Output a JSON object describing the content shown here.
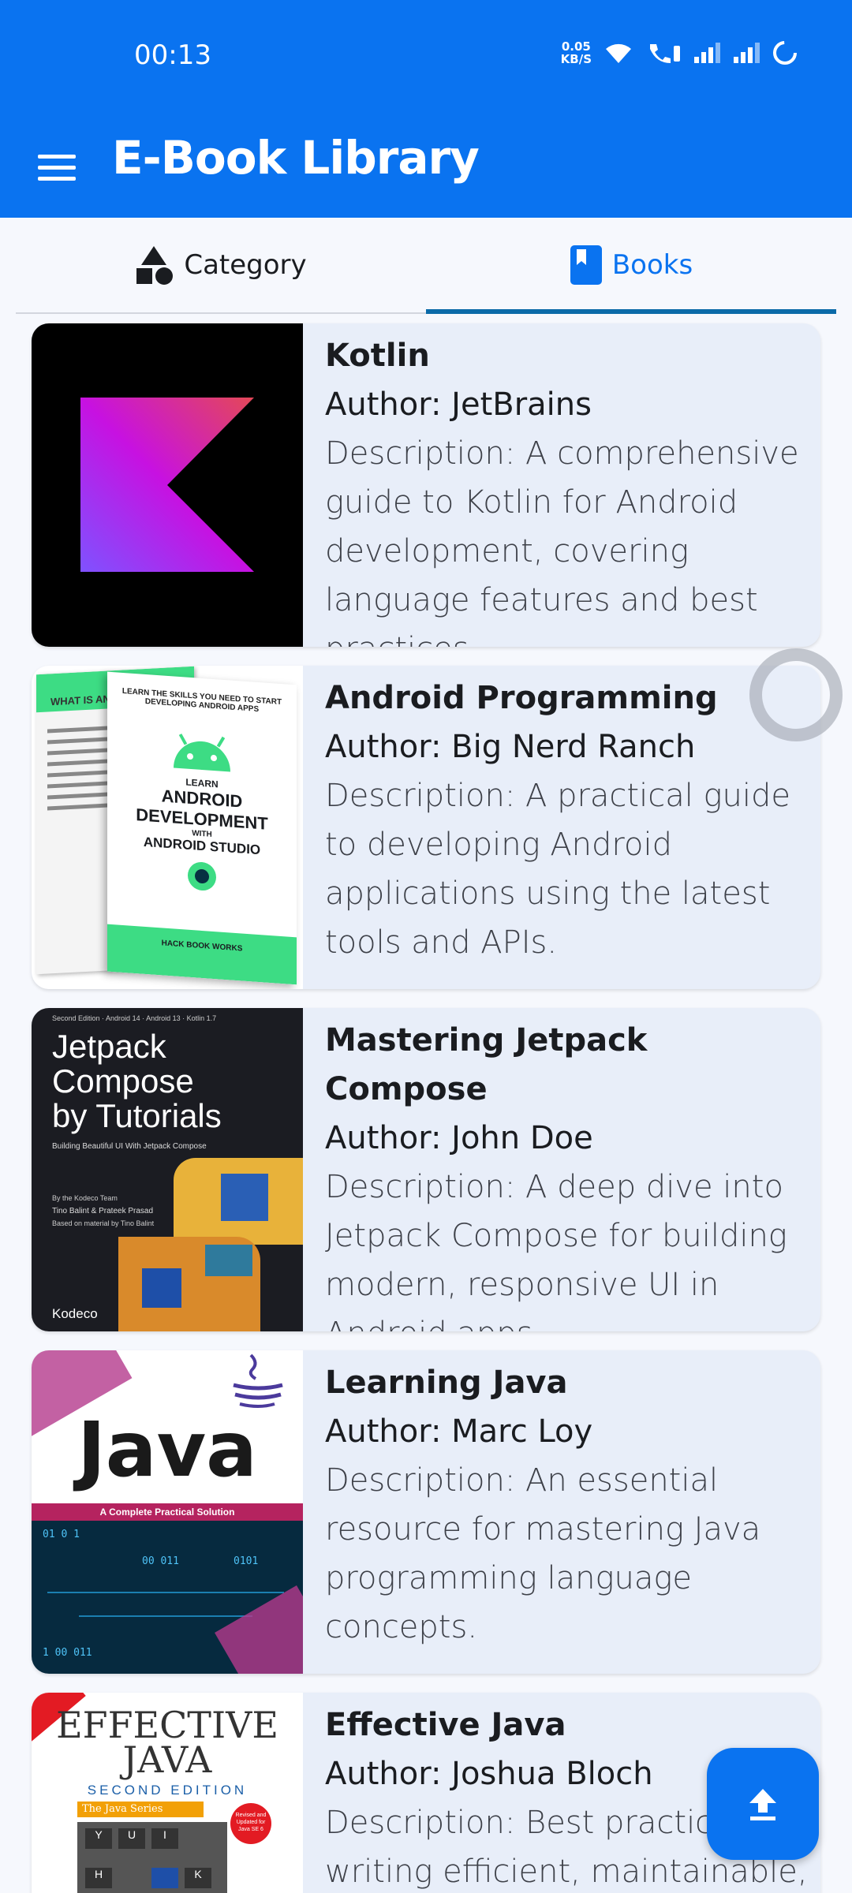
{
  "status": {
    "time": "00:13",
    "speed_top": "0.05",
    "speed_bottom": "KB/S"
  },
  "appbar": {
    "title": "E-Book Library",
    "menu_icon": "menu-icon"
  },
  "tabs": [
    {
      "label": "Category",
      "icon": "shapes-icon",
      "active": false
    },
    {
      "label": "Books",
      "icon": "book-icon",
      "active": true
    }
  ],
  "books": [
    {
      "title": "Kotlin",
      "author": "Author: JetBrains",
      "description": "Description: A comprehensive guide to Kotlin for Android development, covering language features and best practices."
    },
    {
      "title": "Android Programming",
      "author": "Author: Big Nerd Ranch",
      "description": "Description: A practical guide to developing Android applications using the latest tools and APIs."
    },
    {
      "title": "Mastering Jetpack Compose",
      "author": "Author: John Doe",
      "description": "Description: A deep dive into Jetpack Compose for building modern, responsive UI in Android apps."
    },
    {
      "title": "Learning Java",
      "author": "Author: Marc Loy",
      "description": "Description: An essential resource for mastering Java programming language concepts."
    },
    {
      "title": "Effective Java",
      "author": "Author: Joshua Bloch",
      "description": "Description: Best practices for writing efficient, maintainable,"
    }
  ],
  "covers": {
    "android": {
      "top": "LEARN THE SKILLS YOU NEED TO START DEVELOPING ANDROID APPS",
      "line1": "LEARN",
      "line2": "ANDROID",
      "line3": "DEVELOPMENT",
      "line4": "WITH",
      "line5": "ANDROID STUDIO",
      "publisher": "HACK BOOK WORKS",
      "back_heading": "WHAT IS AN"
    },
    "compose": {
      "edition": "Second Edition · Android 14 · Android 13 · Kotlin 1.7",
      "line1": "Jetpack",
      "line2": "Compose",
      "line3": "by Tutorials",
      "subtitle": "Building Beautiful UI With Jetpack Compose",
      "authors1": "By the Kodeco Team",
      "authors2": "Tino Balint & Prateek Prasad",
      "authors3": "Based on material by Tino Balint",
      "publisher": "Kodeco"
    },
    "java": {
      "title": "Java",
      "tagline": "A Complete Practical Solution"
    },
    "effective": {
      "line1": "EFFECTIVE",
      "line2": "JAVA",
      "edition": "SECOND EDITION",
      "series": "The Java Series",
      "badge": "Revised and Updated for Java SE 6"
    }
  },
  "fab": {
    "icon": "upload-icon"
  }
}
